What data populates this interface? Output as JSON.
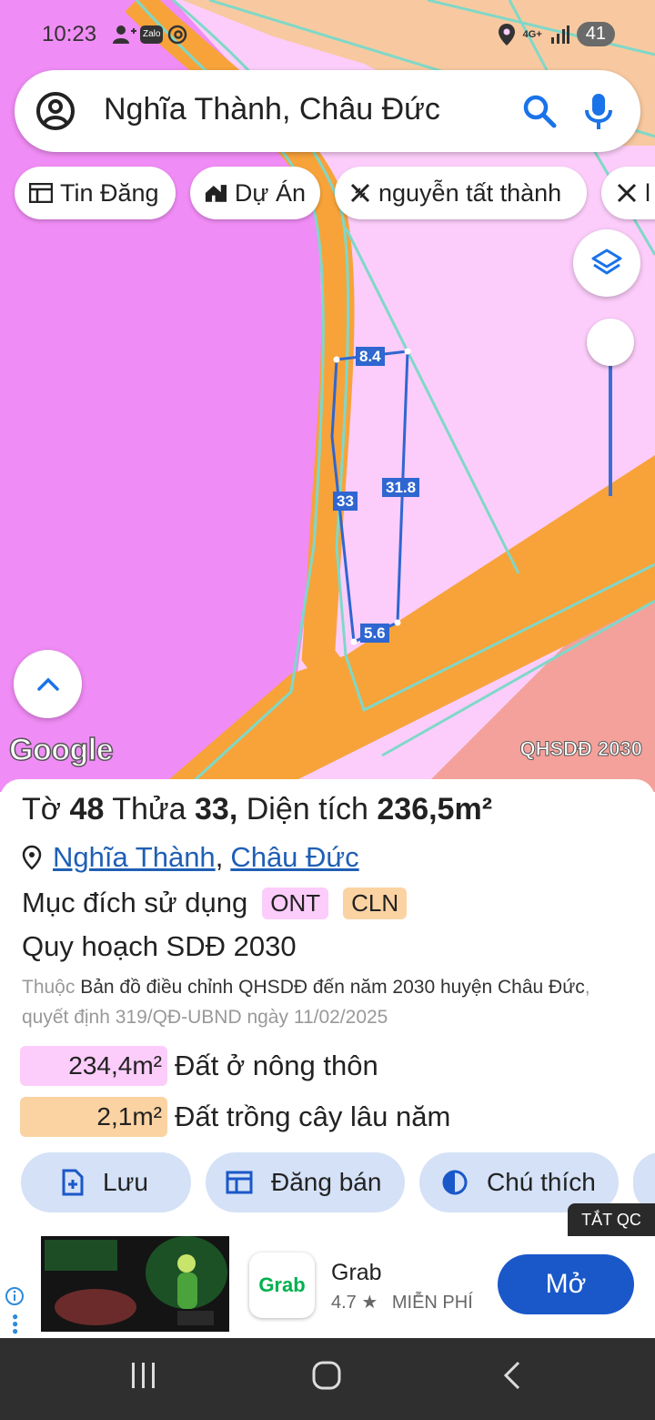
{
  "status_bar": {
    "time": "10:23",
    "zalo": "Zalo",
    "network": "4G+",
    "battery": "41"
  },
  "search": {
    "query": "Nghĩa Thành, Châu Đức",
    "icons": [
      "account-circle-icon",
      "search-icon",
      "mic-icon"
    ]
  },
  "chips": [
    {
      "label": "Tin Đăng",
      "icon": "listing-icon"
    },
    {
      "label": "Dự Án",
      "icon": "project-icon"
    },
    {
      "label": "nguyễn tất thành",
      "icon": "close-x-icon"
    },
    {
      "label": "l",
      "icon": "close-x-icon"
    }
  ],
  "map": {
    "plot_labels": {
      "top": "8.4",
      "left": "33",
      "right": "31.8",
      "bottom": "5.6"
    },
    "logo": "Google",
    "layer_tag": "QHSDĐ 2030",
    "colors": {
      "rural_residential": "#f08cf5",
      "residential_light": "#fccdfa",
      "perennial": "#f7a84e",
      "road_orange": "#f7a33a",
      "salmon": "#f3a19a",
      "plot_outline": "#2f66d0"
    }
  },
  "parcel": {
    "prefix_sheet": "Tờ",
    "sheet": "48",
    "prefix_lot": "Thửa",
    "lot": "33,",
    "prefix_area": "Diện tích",
    "area": "236,5m²",
    "ward": "Nghĩa Thành",
    "comma": ",",
    "district": "Châu Đức",
    "purpose_label": "Mục đích sử dụng",
    "tags": [
      {
        "code": "ONT",
        "color": "#fccdfa"
      },
      {
        "code": "CLN",
        "color": "#fbd3a3"
      }
    ],
    "plan_title": "Quy hoạch SDĐ 2030",
    "plan_note_prefix": "Thuộc",
    "plan_note_map": "Bản đồ điều chỉnh QHSDĐ đến năm 2030 huyện Châu Đức",
    "plan_note_decision": ", quyết định 319/QĐ-UBND ngày 11/02/2025",
    "areas": [
      {
        "value": "234,4m²",
        "desc": "Đất ở nông thôn",
        "color": "#fccdfa"
      },
      {
        "value": "2,1m²",
        "desc": "Đất trồng cây lâu năm",
        "color": "#fbd3a3"
      }
    ]
  },
  "actions": [
    {
      "label": "Lưu",
      "icon": "save-add-icon"
    },
    {
      "label": "Đăng bán",
      "icon": "post-sale-icon"
    },
    {
      "label": "Chú thích",
      "icon": "legend-contrast-icon"
    }
  ],
  "ad": {
    "close_label": "TẮT QC",
    "app_icon_text": "Grab",
    "app_name": "Grab",
    "rating": "4.7 ★",
    "price": "MIỄN PHÍ",
    "cta": "Mở"
  },
  "navbar": [
    "recent-apps-icon",
    "home-icon",
    "back-icon"
  ]
}
